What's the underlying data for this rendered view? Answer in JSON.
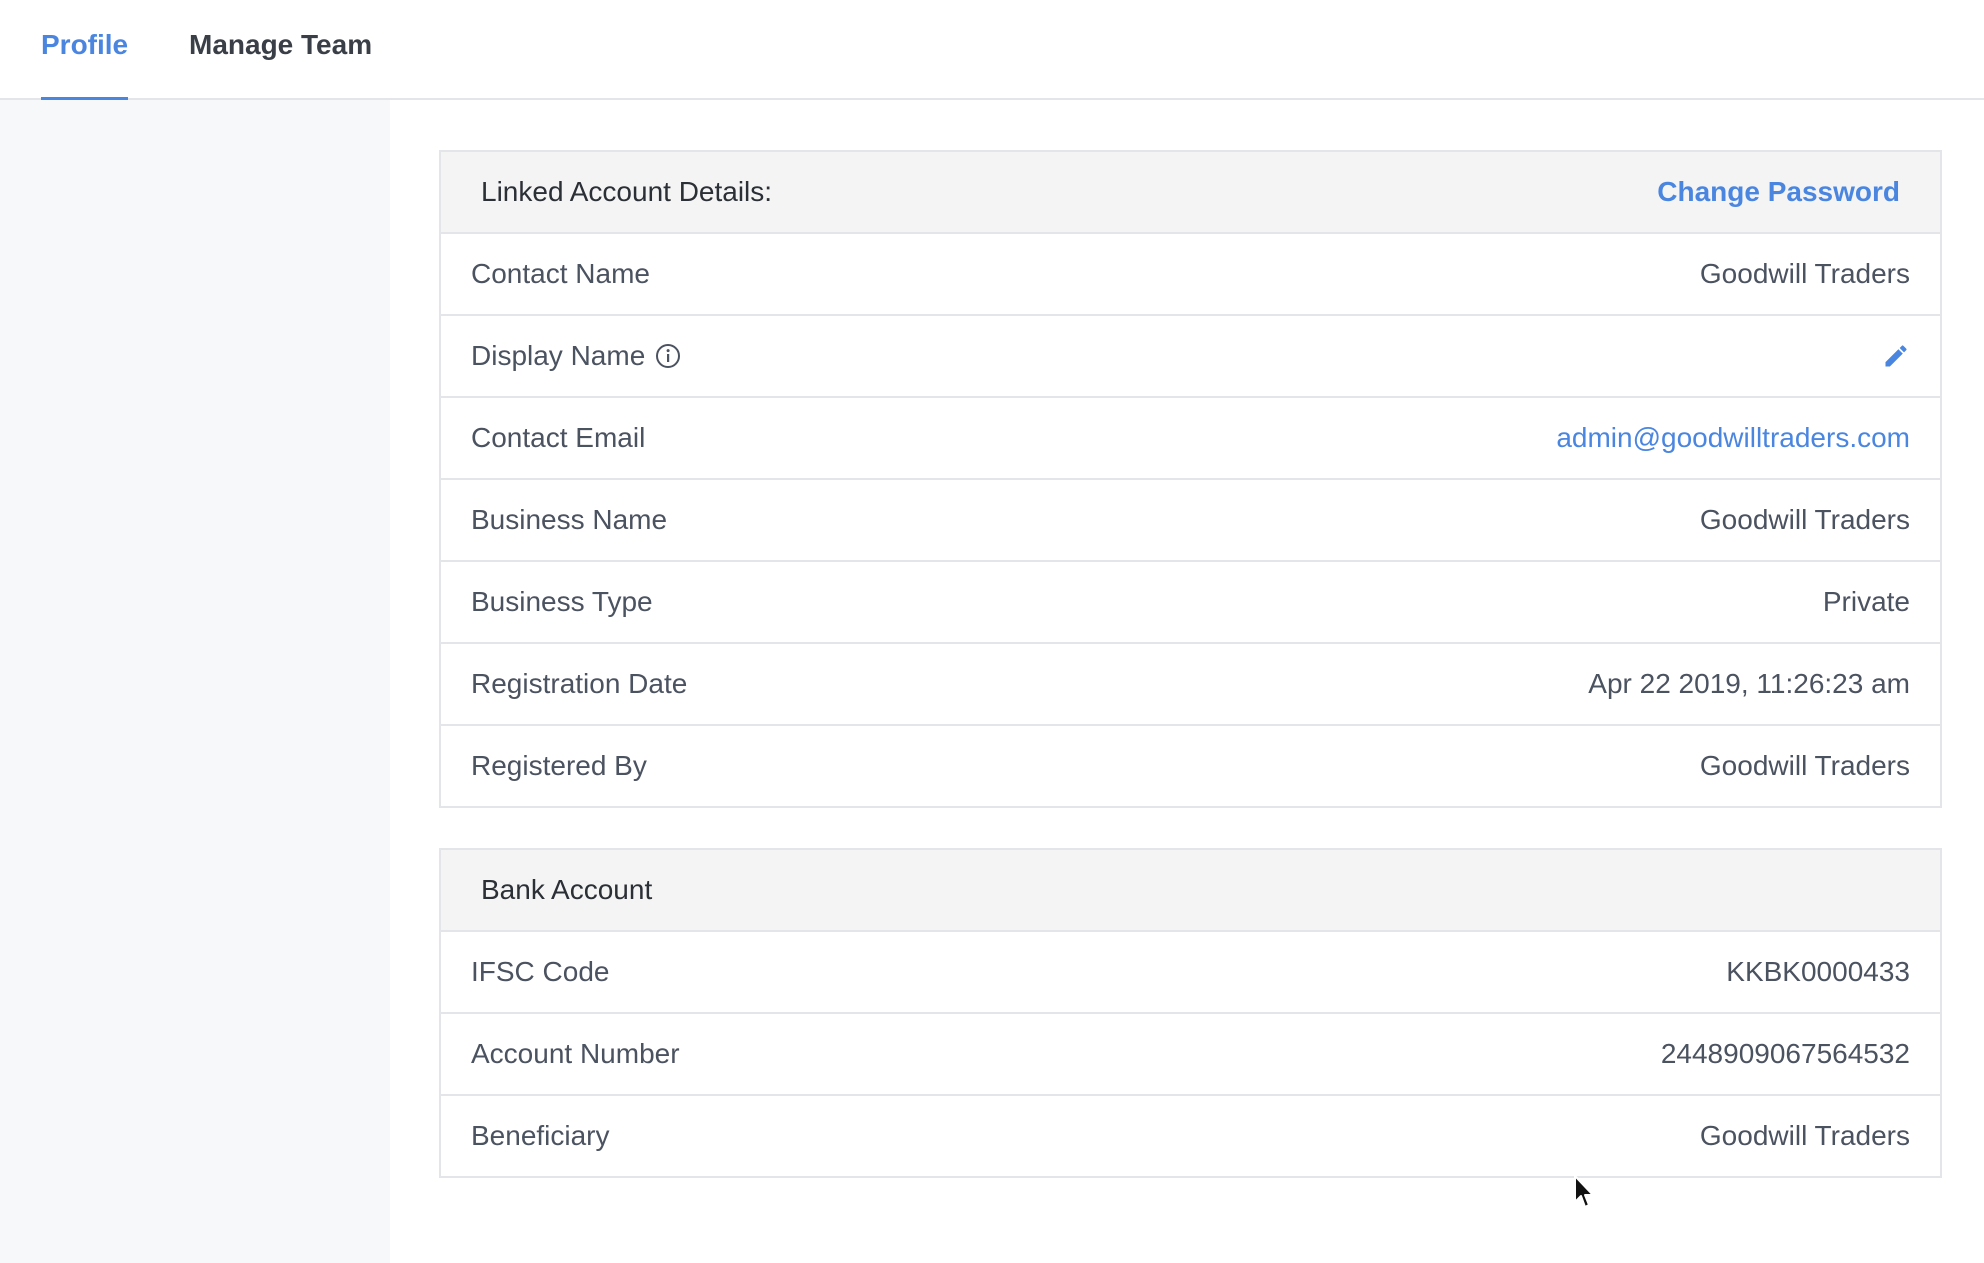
{
  "tabs": [
    {
      "label": "Profile",
      "active": true
    },
    {
      "label": "Manage Team",
      "active": false
    }
  ],
  "linked_account": {
    "title": "Linked Account Details:",
    "action_label": "Change Password",
    "rows": [
      {
        "label": "Contact Name",
        "value": "Goodwill Traders"
      },
      {
        "label": "Display Name",
        "value": ""
      },
      {
        "label": "Contact Email",
        "value": "admin@goodwilltraders.com"
      },
      {
        "label": "Business Name",
        "value": "Goodwill Traders"
      },
      {
        "label": "Business Type",
        "value": "Private"
      },
      {
        "label": "Registration Date",
        "value": "Apr 22 2019, 11:26:23 am"
      },
      {
        "label": "Registered By",
        "value": "Goodwill Traders"
      }
    ]
  },
  "bank_account": {
    "title": "Bank Account",
    "rows": [
      {
        "label": "IFSC Code",
        "value": "KKBK0000433"
      },
      {
        "label": "Account Number",
        "value": "2448909067564532"
      },
      {
        "label": "Beneficiary",
        "value": "Goodwill Traders"
      }
    ]
  },
  "icons": {
    "display_name_info": "info-circle-icon",
    "display_name_edit": "pencil-icon"
  },
  "colors": {
    "accent": "#4a86e0",
    "text": "#4b5260",
    "header_bg": "#f4f4f4",
    "sidebar_bg": "#f7f8fa",
    "border": "#e3e5e8"
  }
}
